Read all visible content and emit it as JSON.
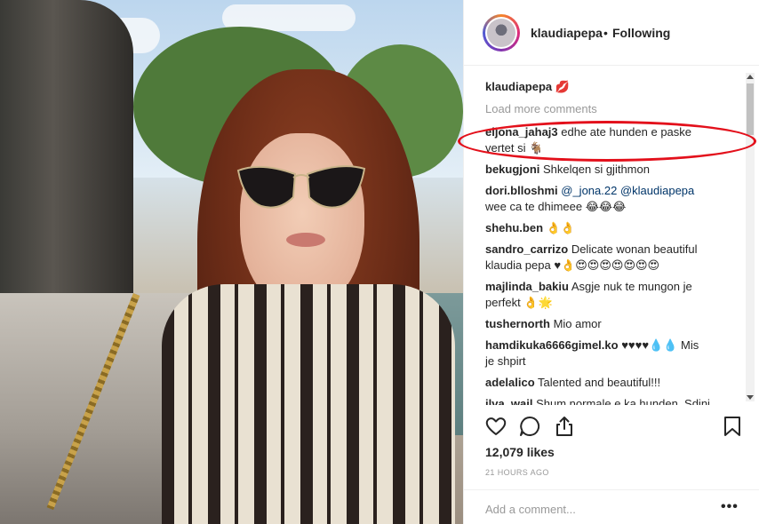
{
  "post": {
    "username": "klaudiapepa",
    "separator": "•",
    "follow_status": "Following",
    "caption_user": "klaudiapepa 💋",
    "load_more": "Load more comments"
  },
  "comments": [
    {
      "user": "eljona_jahaj3",
      "text": " edhe ate hunden e paske",
      "text2": "vertet si 🐐"
    },
    {
      "user": "bekugjoni",
      "text": " Shkelqen si gjithmon"
    },
    {
      "user": "dori.blloshmi",
      "text": " ",
      "mention1": "@_jona.22",
      "mention2": " @klaudiapepa",
      "text2": "wee ca te dhimeee 😂😂😂"
    },
    {
      "user": "shehu.ben",
      "text": " 👌👌"
    },
    {
      "user": "sandro_carrizo",
      "text": " Delicate wonan beautiful",
      "text2": "klaudia pepa ♥👌😍😍😍😍😍😍😍"
    },
    {
      "user": "majlinda_bakiu",
      "text": " Asgje nuk te mungon je",
      "text2": "perfekt 👌🌟"
    },
    {
      "user": "tushernorth",
      "text": " Mio amor"
    },
    {
      "user": "hamdikuka6666gimel.ko",
      "text": " ♥♥♥♥💧💧 Mis",
      "text2": "je shpirt"
    },
    {
      "user": "adelalico",
      "text": " Talented and beautiful!!!"
    },
    {
      "user": "ilva_wail",
      "text": " Shum normale e ka hunden. Sdini"
    }
  ],
  "likes": "12,079 likes",
  "timestamp": "21 HOURS AGO",
  "add_comment_placeholder": "Add a comment...",
  "more_options": "•••",
  "icons": {
    "like": "heart-icon",
    "comment": "comment-icon",
    "share": "share-icon",
    "save": "bookmark-icon"
  },
  "colors": {
    "highlight_ellipse": "#e3101b",
    "mention": "#003569",
    "muted": "#999999"
  }
}
